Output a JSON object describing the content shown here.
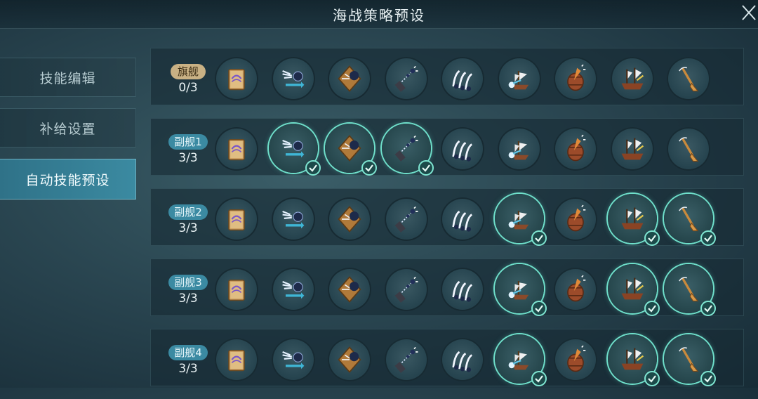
{
  "header": {
    "title": "海战策略预设"
  },
  "sidebar": {
    "items": [
      {
        "label": "技能编辑"
      },
      {
        "label": "补给设置"
      },
      {
        "label": "自动技能预设"
      }
    ]
  },
  "skill_icons": [
    "book-icon",
    "cannonball-dash-icon",
    "explosive-kite-icon",
    "chain-shot-icon",
    "triple-strike-icon",
    "ship-water-icon",
    "barrel-icon",
    "warship-icon",
    "oar-icon"
  ],
  "rows": [
    {
      "label": "旗舰",
      "count": "0/3",
      "selected": []
    },
    {
      "label": "副舰1",
      "count": "3/3",
      "selected": [
        1,
        2,
        3
      ]
    },
    {
      "label": "副舰2",
      "count": "3/3",
      "selected": [
        5,
        7,
        8
      ]
    },
    {
      "label": "副舰3",
      "count": "3/3",
      "selected": [
        5,
        7,
        8
      ]
    },
    {
      "label": "副舰4",
      "count": "3/3",
      "selected": [
        5,
        7,
        8
      ]
    }
  ],
  "colors": {
    "accent": "#3b8aa2",
    "selected_ring": "#6fe0cb",
    "flagship_badge": "#c9b184"
  }
}
